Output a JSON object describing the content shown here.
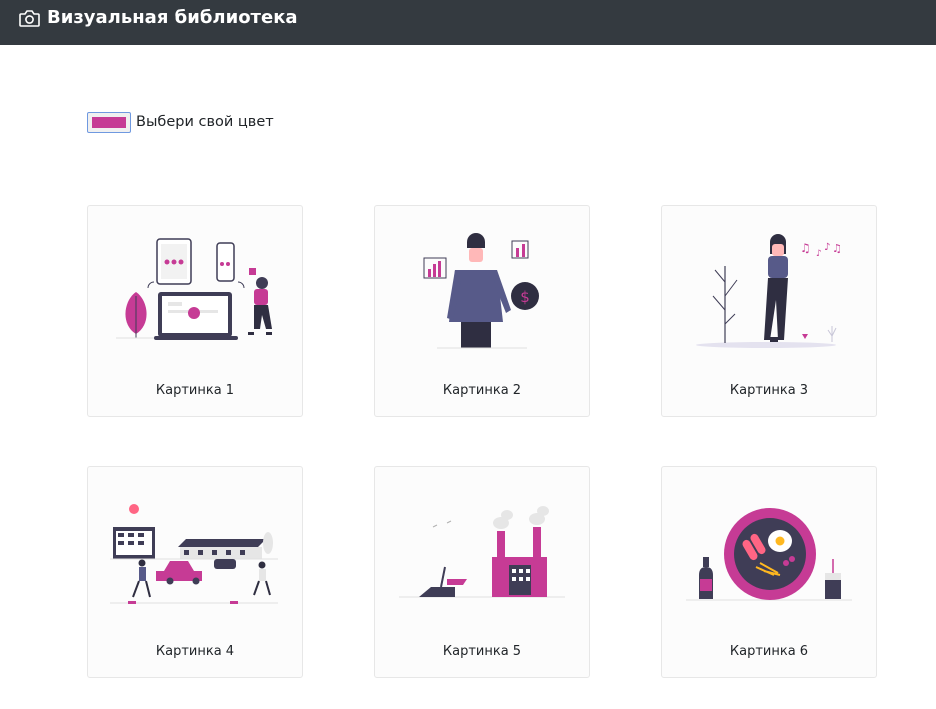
{
  "header": {
    "title": "Визуальная библиотека",
    "icon": "camera-icon",
    "background": "#343a40"
  },
  "color_picker": {
    "label": "Выбери свой цвет",
    "value": "#c63b95"
  },
  "gallery": [
    {
      "caption": "Картинка 1"
    },
    {
      "caption": "Картинка 2"
    },
    {
      "caption": "Картинка 3"
    },
    {
      "caption": "Картинка 4"
    },
    {
      "caption": "Картинка 5"
    },
    {
      "caption": "Картинка 6"
    }
  ]
}
